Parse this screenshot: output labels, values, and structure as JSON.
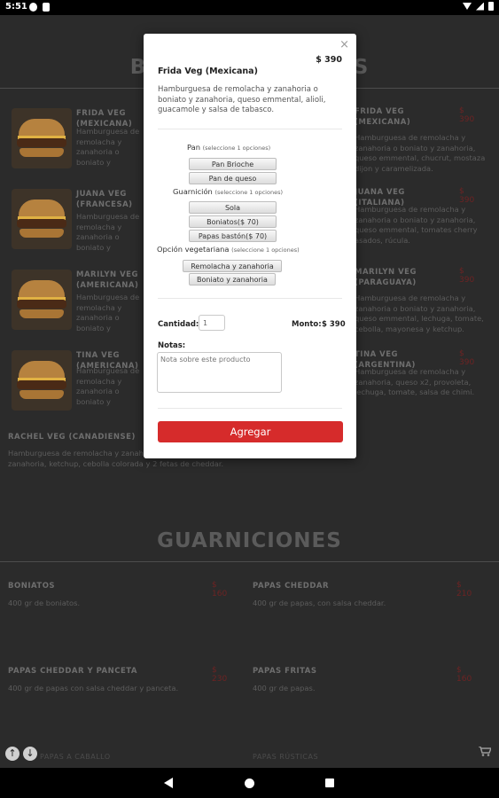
{
  "status_bar": {
    "time": "5:51"
  },
  "menu": {
    "burgers_title": "BURGERS VEGANAS",
    "guarniciones_title": "GUARNICIONES",
    "burgers": [
      {
        "name": "FRIDA VEG (MEXICANA)",
        "desc": "Hamburguesa de remolacha y zanahoria o boniato y zanahoria, queso emmental, alioli, guacamole y salsa de tabasco.",
        "price": "$ 390"
      },
      {
        "name": "FRIDA VEG (MEXICANA)",
        "desc": "Hamburguesa de remolacha y zanahoria o boniato y zanahoria, queso emmental, chucrut, mostaza dijon y caramelizada.",
        "price": "$ 390"
      },
      {
        "name": "JUANA VEG (FRANCESA)",
        "desc": "Hamburguesa de remolacha y zanahoria o boniato y zanahoria, queso emmental, queso portobello, cebolla.",
        "price": ""
      },
      {
        "name": "JUANA VEG (ITALIANA)",
        "desc": "Hamburguesa de remolacha y zanahoria o boniato y zanahoria, queso emmental, tomates cherry asados, rúcula.",
        "price": "$ 390"
      },
      {
        "name": "MARILYN VEG (AMERICANA)",
        "desc": "Hamburguesa de remolacha y zanahoria o boniato y zanahoria, queso cheddar x2, bbq, huevo, cebolla caramelizada.",
        "price": ""
      },
      {
        "name": "MARILYN VEG (PARAGUAYA)",
        "desc": "Hamburguesa de remolacha y zanahoria o boniato y zanahoria, queso emmental, lechuga, tomate, cebolla, mayonesa y ketchup.",
        "price": "$ 390"
      },
      {
        "name": "TINA VEG (AMERICANA)",
        "desc": "Hamburguesa de remolacha y zanahoria o boniato y zanahoria, queso cheddar x2, pepinillos, bbq.",
        "price": ""
      },
      {
        "name": "TINA VEG (ARGENTINA)",
        "desc": "Hamburguesa de remolacha y zanahoria, queso x2, provoleta, lechuga, tomate, salsa de chimi.",
        "price": "$ 390"
      },
      {
        "name": "RACHEL VEG (CANADIENSE)",
        "desc": "Hamburguesa de remolacha y zanahoria o boniato y zanahoria, ketchup, cebolla colorada y 2 fetas de cheddar.",
        "price": ""
      }
    ],
    "sides": [
      {
        "name": "BONIATOS",
        "desc": "400 gr de boniatos.",
        "price": "$ 160"
      },
      {
        "name": "PAPAS CHEDDAR",
        "desc": "400 gr de papas, con salsa cheddar.",
        "price": "$ 210"
      },
      {
        "name": "PAPAS CHEDDAR Y PANCETA",
        "desc": "400 gr de papas con salsa cheddar y panceta.",
        "price": "$ 230"
      },
      {
        "name": "PAPAS FRITAS",
        "desc": "400 gr de papas.",
        "price": "$ 160"
      }
    ],
    "footer_left": "PAPAS A CABALLO",
    "footer_right": "PAPAS RÚSTICAS"
  },
  "modal": {
    "close": "×",
    "title": "Frida Veg (Mexicana)",
    "price": "$ 390",
    "description": "Hamburguesa de remolacha y zanahoria o boniato y zanahoria, queso emmental, alioli, guacamole y salsa de tabasco.",
    "groups": [
      {
        "label": "Pan",
        "hint": "(seleccione 1 opciones)",
        "options": [
          "Pan Brioche",
          "Pan de queso"
        ]
      },
      {
        "label": "Guarnición",
        "hint": "(seleccione 1 opciones)",
        "options": [
          "Sola",
          "Boniatos($ 70)",
          "Papas bastón($ 70)"
        ]
      },
      {
        "label": "Opción vegetariana",
        "hint": "(seleccione 1 opciones)",
        "options": [
          "Remolacha y zanahoria",
          "Boniato y zanahoria"
        ]
      }
    ],
    "quantity_label": "Cantidad:",
    "quantity_value": "1",
    "amount_label": "Monto:",
    "amount_value": "$ 390",
    "notes_label": "Notas:",
    "notes_placeholder": "Nota sobre este producto",
    "submit": "Agregar"
  },
  "colors": {
    "accent": "#d62b2b",
    "overlay_bg": "#2b2b2b"
  },
  "icons": [
    "wifi-icon",
    "battery-icon",
    "cart-icon",
    "arrow-up-icon",
    "arrow-down-icon"
  ]
}
